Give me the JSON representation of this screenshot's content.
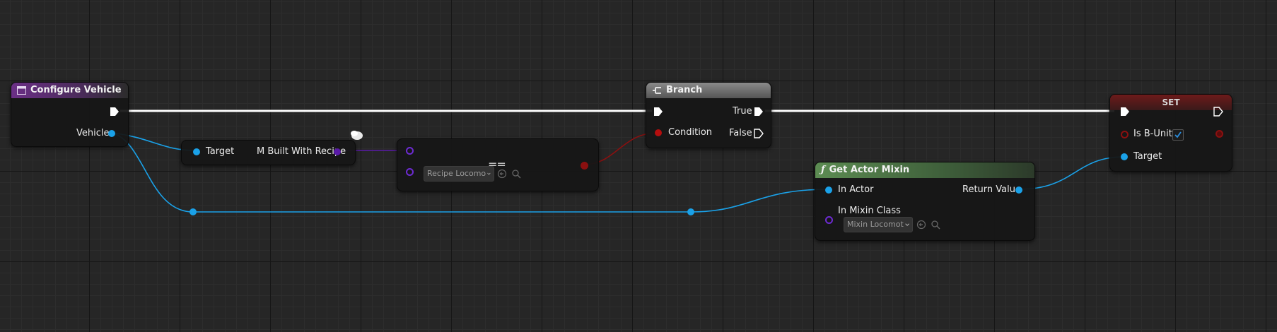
{
  "nodes": {
    "configure_vehicle": {
      "title": "Configure Vehicle",
      "output_pin": "Vehicle"
    },
    "m_built_with_recipe": {
      "input_pin": "Target",
      "output_pin": "M Built With Recipe"
    },
    "equals": {
      "operator": "==",
      "combo_value": "Recipe Locomo"
    },
    "branch": {
      "title": "Branch",
      "condition_pin": "Condition",
      "true_pin": "True",
      "false_pin": "False"
    },
    "get_actor_mixin": {
      "title": "Get Actor Mixin",
      "func_glyph": "ƒ",
      "in_actor": "In Actor",
      "in_mixin_class": "In Mixin Class",
      "mixin_combo": "Mixin Locomot",
      "return_value": "Return Value"
    },
    "set": {
      "title": "SET",
      "var_pin": "Is B-Unit",
      "checked": true,
      "target_pin": "Target"
    }
  },
  "colors": {
    "exec_wire": "#ffffff",
    "object_wire": "#1aa1e8",
    "class_wire": "#5a1aa8",
    "bool_wire": "#8b1010"
  },
  "icons": [
    "event-icon",
    "branch-icon",
    "function-icon",
    "exec-pin-icon",
    "chevron-down-icon",
    "use-selected-icon",
    "browse-icon",
    "checkmark-icon",
    "comment-bubble-icon"
  ]
}
